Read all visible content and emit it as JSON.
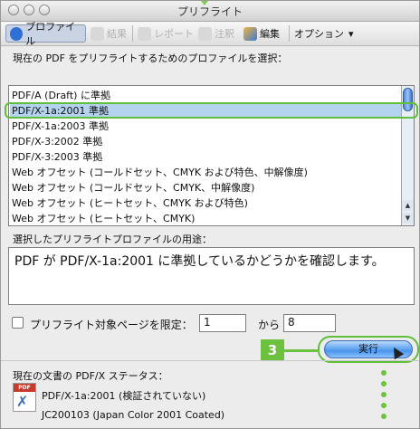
{
  "window": {
    "title": "プリフライト"
  },
  "toolbar": {
    "profiles_label": "プロファイル",
    "results_label": "結果",
    "report_label": "レポート",
    "comments_label": "注釈",
    "edit_label": "編集",
    "options_label": "オプション",
    "options_chevron": "▾"
  },
  "main": {
    "instruction": "現在の PDF をプリフライトするためのプロファイルを選択：",
    "profiles": [
      "PDF/A (Draft) に準拠",
      "PDF/X-1a:2001 準拠",
      "PDF/X-1a:2003 準拠",
      "PDF/X-3:2002 準拠",
      "PDF/X-3:2003 準拠",
      "Web オフセット (コールドセット、CMYK および特色、中解像度)",
      "Web オフセット (コールドセット、CMYK、中解像度)",
      "Web オフセット (ヒートセット、CMYK および特色)",
      "Web オフセット (ヒートセット、CMYK)"
    ],
    "selected_index": 1,
    "use_label": "選択したプリフライトプロファイルの用途：",
    "use_text": "PDF が PDF/X-1a:2001 に準拠しているかどうかを確認します。",
    "limit_label": "プリフライト対象ページを限定：",
    "page_from": "1",
    "page_to_label": "から",
    "page_to": "8",
    "run_label": "実行",
    "step_number": "3"
  },
  "status": {
    "heading": "現在の文書の PDF/X ステータス：",
    "line1": "PDF/X-1a:2001 (検証されていない)",
    "line2": "JC200103 (Japan Color 2001 Coated)",
    "icon_label": "PDF"
  },
  "colors": {
    "accent_green": "#6cc23f",
    "selection_blue": "#b3d3ee"
  }
}
